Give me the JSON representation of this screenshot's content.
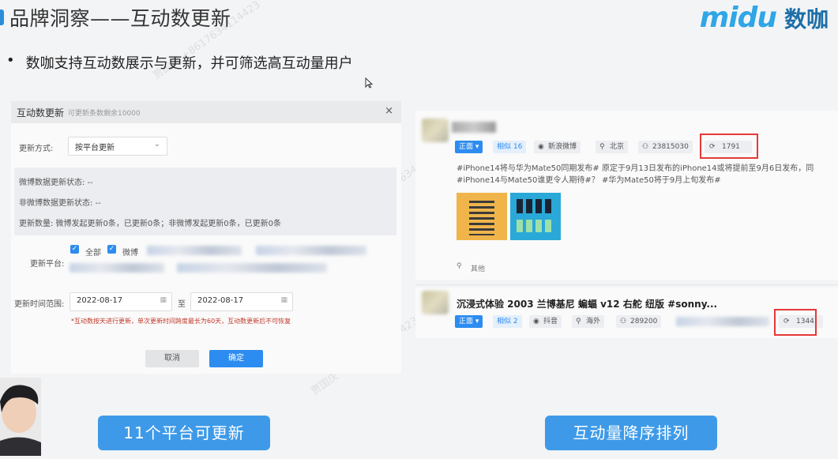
{
  "slide": {
    "title": "品牌洞察——互动数更新",
    "bullet_marker": "•",
    "bullet": "数咖支持互动数展示与更新，并可筛选高互动量用户"
  },
  "logo": {
    "en": "midu",
    "cn": "数咖"
  },
  "dialog": {
    "title": "互动数更新",
    "subtitle": "可更新条数剩余10000",
    "close": "×",
    "method_label": "更新方式:",
    "method_value": "按平台更新",
    "status_weibo": "微博数据更新状态:  --",
    "status_non_weibo": "非微博数据更新状态:  --",
    "update_count": "更新数量:  微博发起更新0条，已更新0条；非微博发起更新0条，已更新0条",
    "platform_label": "更新平台:",
    "platform_all": "全部",
    "platform_weibo": "微博",
    "time_label": "更新时间范围:",
    "date_from": "2022-08-17",
    "date_to_sep": "至",
    "date_to": "2022-08-17",
    "note": "*互动数按天进行更新，单次更新时间跨度最长为60天，互动数更新后不可恢复",
    "cancel": "取消",
    "confirm": "确定"
  },
  "posts": [
    {
      "sentiment": "正面 ▾",
      "similar": "相似 16",
      "platform": "新浪微博",
      "location": "北京",
      "fans": "23815030",
      "interactions": "1791",
      "text_line1": "#iPhone14将与华为Mate50同期发布# 原定于9月13日发布的iPhone14或将提前至9月6日发布，同",
      "text_line2": "#iPhone14与Mate50谁更令人期待#？ #华为Mate50将于9月上旬发布#",
      "footer_loc": "其他"
    },
    {
      "title": "沉浸式体验 2003 兰博基尼 蝙蝠 v12 右舵 纽版 #sonny...",
      "sentiment": "正面 ▾",
      "similar": "相似 2",
      "platform": "抖音",
      "location": "海外",
      "fans": "289200",
      "interactions": "1344"
    }
  ],
  "bottom_buttons": {
    "left": "11个平台可更新",
    "right": "互动量降序排列"
  },
  "watermark": "贾国庆 +8617634114423",
  "colors": {
    "accent": "#2d8cf0",
    "highlight": "#e53935",
    "callout": "#3e9ae8"
  }
}
